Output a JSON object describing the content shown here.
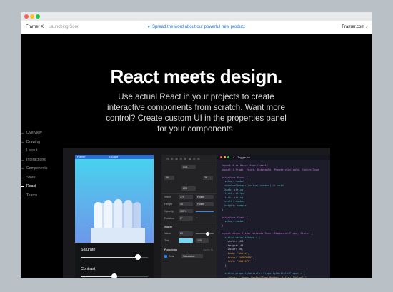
{
  "window": {
    "brand": "Framer X",
    "brand_sub": "Launching Soon",
    "tweet_text": "Spread the word about our powerful new product",
    "site_link": "Framer.com ›"
  },
  "hero": {
    "title": "React meets design.",
    "line1": "Use actual React in your projects to create",
    "line2": "interactive components from scratch. Want more",
    "line3": "control? Create custom UI in the properties panel",
    "line4": "for your components."
  },
  "nav": {
    "items": [
      "Overview",
      "Drawing",
      "Layout",
      "Interactions",
      "Components",
      "Store",
      "React",
      "Teams"
    ],
    "active_index": 6
  },
  "phone": {
    "carrier": "Framer",
    "time": "9:41 AM",
    "saturate_label": "Saturate",
    "contrast_label": "Contrast",
    "saturate_value": 0.85,
    "contrast_value": 0.5
  },
  "props": {
    "w": "414",
    "x": "36",
    "y": "36",
    "h": "253",
    "width_label": "Width",
    "width_value": "375",
    "width_mode": "Fixed",
    "height_label": "Height",
    "height_value": "40",
    "height_mode": "Fixed",
    "opacity_label": "Opacity",
    "opacity_value": "100%",
    "rotation_label": "Rotation",
    "rotation_value": "0°",
    "section_slider": "Slider",
    "value_label": "Value",
    "value_value": "60",
    "tint_label": "Tint",
    "tint_value": "100",
    "section_functions": "Functions",
    "apply_label": "Apply to",
    "fx_name": "Deta",
    "fx_value": "Saturation",
    "tint_color": "#79d6f0"
  },
  "editor": {
    "filename": "Toggle.tsx",
    "code": [
      "import * as React from \"react\"",
      "import { Frame, Point, Draggable, PropertyControls, ControlType",
      "",
      "interface Props {",
      "  value: number",
      "  onValueChange: (value: number) => void",
      "  knob: string",
      "  track: string",
      "  tint: string",
      "  width: number",
      "  height: number",
      "}",
      "",
      "interface State {",
      "  value: number",
      "}",
      "",
      "export class Slider extends React.Component<Props, State> {",
      "  static defaultProps = {",
      "    width: 128,",
      "    height: 40,",
      "    value: 50,",
      "    knob: \"white\",",
      "    track: \"#DDDDDD\",",
      "    tint: \"#0076FF\",",
      "  }",
      "",
      "  static propertyControls: PropertyControls<Props> = {",
      "    value: { type: ControlType.Number, title: \"Value\" },",
      "    tint: { type: ControlType.Color, title: \"Tint\" },"
    ]
  },
  "colors": {
    "page_bg": "#b9c0c6",
    "accent_blue": "#1b74e4",
    "syntax_keyword": "#c678dd",
    "syntax_type": "#56b6c2",
    "syntax_string": "#e6a34a"
  }
}
